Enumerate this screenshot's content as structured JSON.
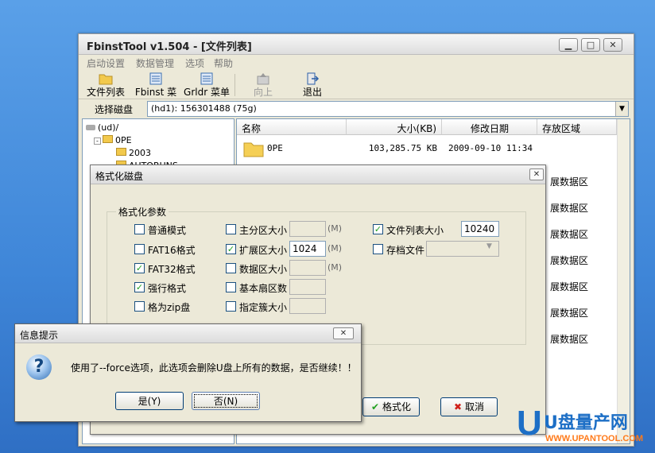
{
  "main": {
    "title": "FbinstTool v1.504 - [文件列表]",
    "window_buttons": [
      "▁",
      "□",
      "✕"
    ],
    "menu": [
      "启动设置",
      "数据管理",
      "选项",
      "帮助"
    ],
    "toolbar": {
      "file_list": "文件列表",
      "fbinst_menu": "Fbinst 菜单",
      "grldr_menu": "Grldr 菜单",
      "up": "向上",
      "exit": "退出"
    },
    "disk_label": "选择磁盘",
    "disk_value": "(hd1): 156301488 (75g)",
    "tree": [
      "(ud)/",
      "0PE",
      "2003",
      "AUTORUNS"
    ],
    "columns": [
      "名称",
      "大小(KB)",
      "修改日期",
      "存放区域"
    ],
    "rows": [
      {
        "name": "0PE",
        "size": "103,285.75 KB",
        "date": "2009-09-10 11:34"
      }
    ],
    "ext_area": [
      "展数据区",
      "展数据区",
      "展数据区",
      "展数据区",
      "展数据区",
      "展数据区",
      "展数据区"
    ]
  },
  "format_dialog": {
    "title": "格式化磁盘",
    "group_title": "格式化参数",
    "col1": [
      {
        "label": "普通模式",
        "checked": false
      },
      {
        "label": "FAT16格式",
        "checked": false
      },
      {
        "label": "FAT32格式",
        "checked": true
      },
      {
        "label": "强行格式",
        "checked": true
      },
      {
        "label": "格为zip盘",
        "checked": false
      }
    ],
    "col2": [
      {
        "label": "主分区大小",
        "checked": false,
        "value": "",
        "unit": "(M)"
      },
      {
        "label": "扩展区大小",
        "checked": true,
        "value": "1024",
        "unit": "(M)"
      },
      {
        "label": "数据区大小",
        "checked": false,
        "value": "",
        "unit": "(M)"
      },
      {
        "label": "基本扇区数",
        "checked": false,
        "value": "",
        "unit": ""
      },
      {
        "label": "指定簇大小",
        "checked": false,
        "value": "",
        "unit": ""
      }
    ],
    "col3": [
      {
        "label": "文件列表大小",
        "checked": true,
        "value": "10240"
      },
      {
        "label": "存档文件",
        "checked": false,
        "value": ""
      }
    ],
    "format_button": "格式化",
    "cancel_button": "取消"
  },
  "info_dialog": {
    "title": "信息提示",
    "message": "使用了--force选项，此选项会删除U盘上所有的数据，是否继续！！",
    "yes_button": "是(Y)",
    "no_button": "否(N)"
  },
  "watermark": {
    "brand": "U盘量产网",
    "url": "WWW.UPANTOOL.COM"
  },
  "colors": {
    "desktop": "#3f86d8",
    "window": "#ece9d8",
    "check": "#21a121",
    "cancel_x": "#d0201a"
  }
}
